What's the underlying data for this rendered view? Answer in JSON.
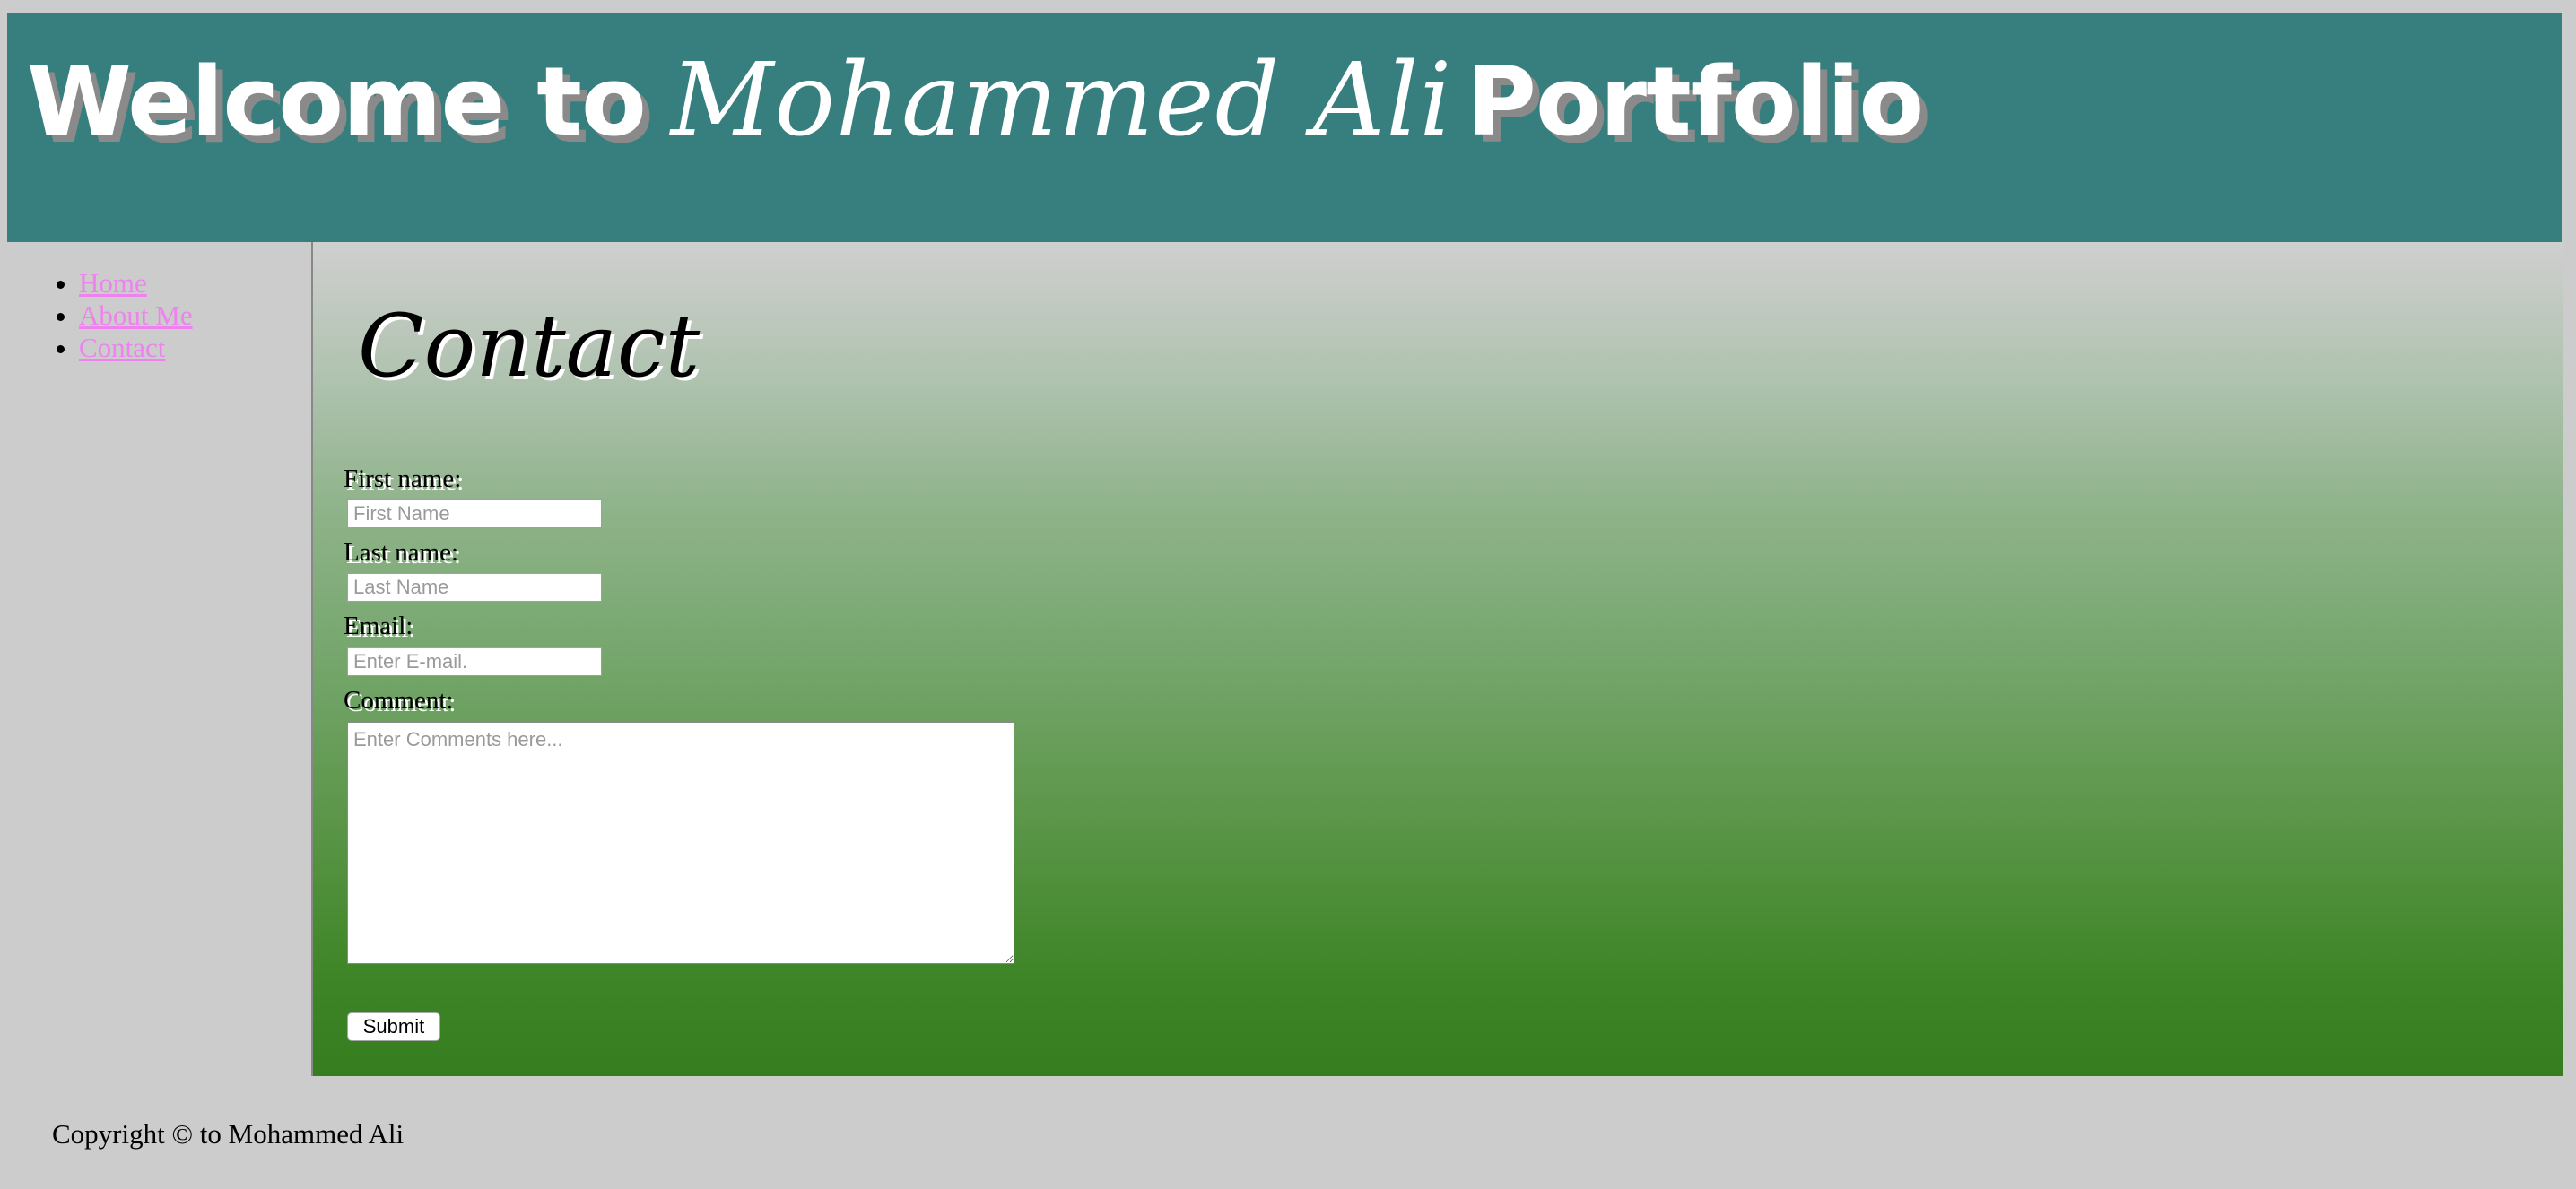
{
  "header": {
    "title_prefix": "Welcome to",
    "title_name": "Mohammed Ali",
    "title_suffix": "Portfolio"
  },
  "nav": {
    "items": [
      {
        "label": "Home"
      },
      {
        "label": "About Me"
      },
      {
        "label": "Contact"
      }
    ]
  },
  "main": {
    "heading": "Contact",
    "form": {
      "first_name_label": "First name:",
      "first_name_placeholder": "First Name",
      "first_name_value": "",
      "last_name_label": "Last name:",
      "last_name_placeholder": "Last Name",
      "last_name_value": "",
      "email_label": "Email:",
      "email_placeholder": "Enter E-mail.",
      "email_value": "",
      "comment_label": "Comment:",
      "comment_placeholder": "Enter Comments here...",
      "comment_value": "",
      "submit_label": "Submit"
    }
  },
  "footer": {
    "copyright": "Copyright © to Mohammed Ali"
  },
  "colors": {
    "header_bg": "#377f7e",
    "page_bg": "#cccccc",
    "link": "#ee82ee",
    "gradient_top": "#cfcfcf",
    "gradient_bottom": "#357d1e"
  }
}
